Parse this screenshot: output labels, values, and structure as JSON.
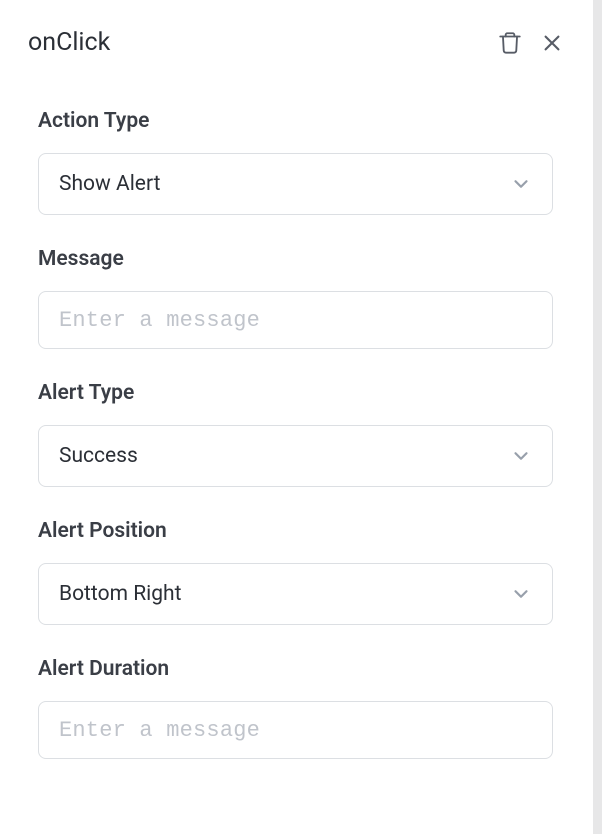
{
  "header": {
    "title": "onClick"
  },
  "fields": {
    "action_type": {
      "label": "Action Type",
      "value": "Show Alert"
    },
    "message": {
      "label": "Message",
      "placeholder": "Enter a message",
      "value": ""
    },
    "alert_type": {
      "label": "Alert Type",
      "value": "Success"
    },
    "alert_position": {
      "label": "Alert Position",
      "value": "Bottom Right"
    },
    "alert_duration": {
      "label": "Alert Duration",
      "placeholder": "Enter a message",
      "value": ""
    }
  }
}
